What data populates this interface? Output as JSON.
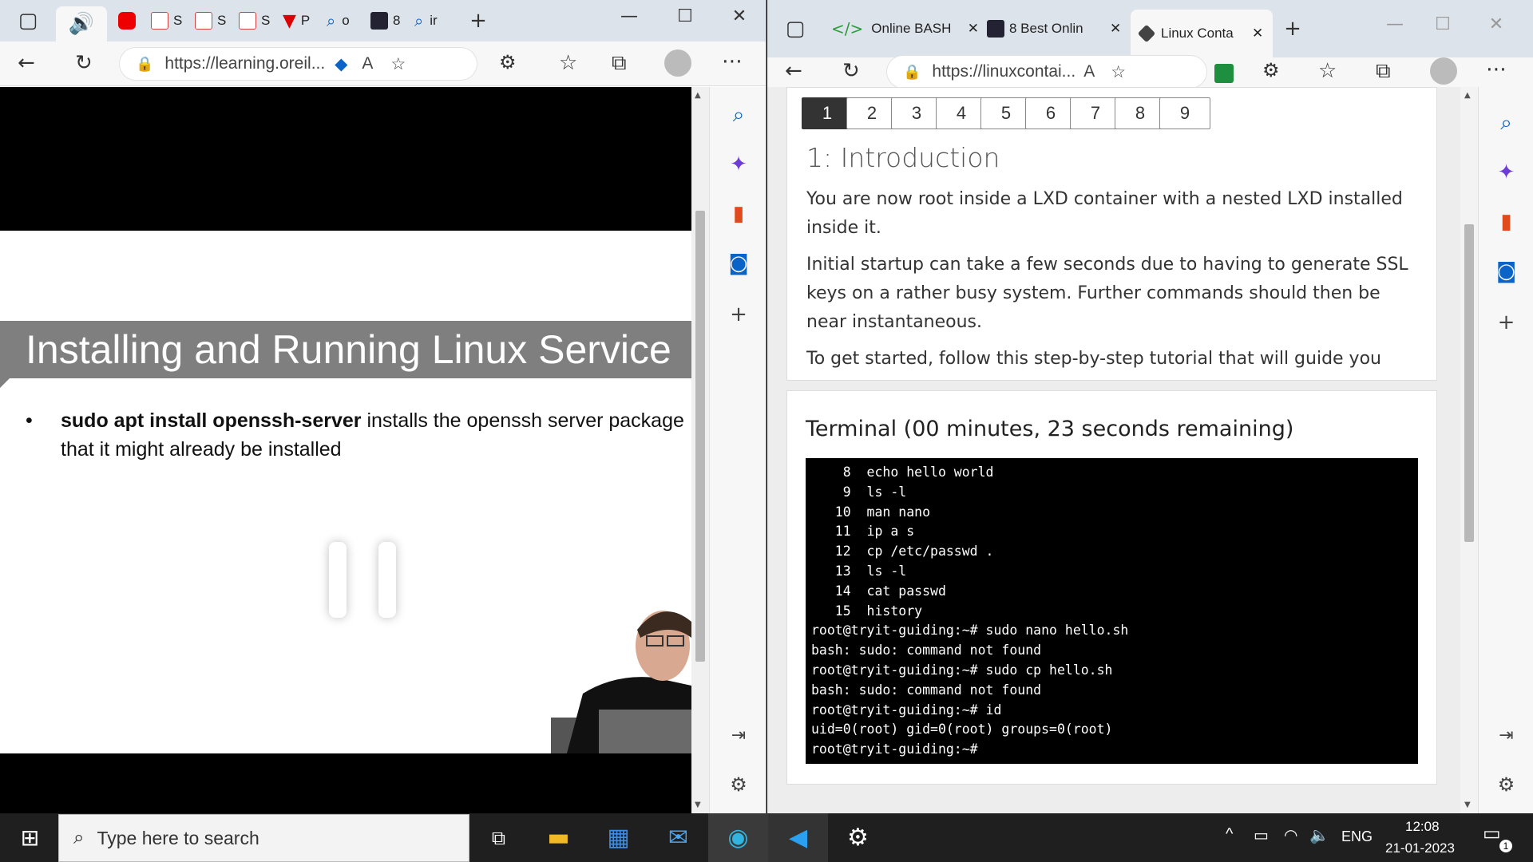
{
  "left_window": {
    "tabs": [
      {
        "label": "",
        "icon": "speaker-icon"
      },
      {
        "label": "",
        "icon": "youtube-icon"
      },
      {
        "label": "S",
        "icon": "pdf-icon"
      },
      {
        "label": "S",
        "icon": "pdf-icon"
      },
      {
        "label": "S",
        "icon": "pdf-icon"
      },
      {
        "label": "P",
        "icon": "red-v-icon"
      },
      {
        "label": "o",
        "icon": "search-icon"
      },
      {
        "label": "8",
        "icon": "fossmint-icon"
      },
      {
        "label": "ir",
        "icon": "search-icon"
      }
    ],
    "address_url": "https://learning.oreil...",
    "slide_title": "Installing and Running Linux Service",
    "bullet_bold": "sudo apt install openssh-server",
    "bullet_rest": " installs the openssh server package",
    "bullet_line2": "that it might already be installed"
  },
  "right_window": {
    "tabs": [
      {
        "label": "Online BASH",
        "icon": "code-icon"
      },
      {
        "label": "8 Best Onlin",
        "icon": "fossmint-icon"
      },
      {
        "label": "Linux Conta",
        "icon": "linux-containers-icon"
      }
    ],
    "address_url": "https://linuxcontai...",
    "steps": [
      "1",
      "2",
      "3",
      "4",
      "5",
      "6",
      "7",
      "8",
      "9"
    ],
    "active_step": "1",
    "lesson_title": "1: Introduction",
    "paragraphs": [
      "You are now root inside a LXD container with a nested LXD installed inside it.",
      "Initial startup can take a few seconds due to having to generate SSL keys on a rather busy system. Further commands should then be near instantaneous.",
      "To get started, follow this step-by-step tutorial that will guide you"
    ],
    "terminal_title": "Terminal (00 minutes, 23 seconds remaining)",
    "terminal_lines": [
      "    8  echo hello world",
      "    9  ls -l",
      "   10  man nano",
      "   11  ip a s",
      "   12  cp /etc/passwd .",
      "   13  ls -l",
      "   14  cat passwd",
      "   15  history",
      "root@tryit-guiding:~# sudo nano hello.sh",
      "bash: sudo: command not found",
      "root@tryit-guiding:~# sudo cp hello.sh",
      "bash: sudo: command not found",
      "root@tryit-guiding:~# id",
      "uid=0(root) gid=0(root) groups=0(root)",
      "root@tryit-guiding:~# "
    ]
  },
  "taskbar": {
    "search_placeholder": "Type here to search",
    "language": "ENG",
    "time": "12:08",
    "date": "21-01-2023",
    "notification_count": "1"
  },
  "colors": {
    "terminal_bg": "#000000",
    "slide_banner": "#7f7f7f",
    "taskbar_bg": "#1f1f1f",
    "active_step_bg": "#333333"
  }
}
